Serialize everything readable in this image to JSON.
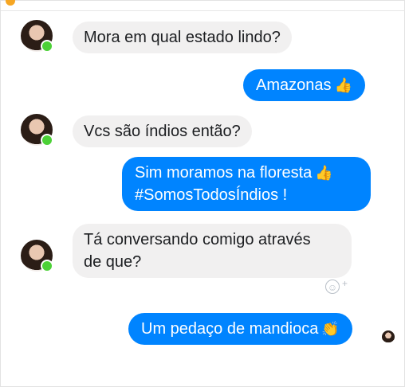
{
  "messages": [
    {
      "from": "them",
      "text": "Mora em qual estado lindo?"
    },
    {
      "from": "me",
      "text": "Amazonas",
      "emoji": "👍"
    },
    {
      "from": "them",
      "text": "Vcs são índios então?"
    },
    {
      "from": "me",
      "line1": "Sim moramos na floresta",
      "emoji": "👍",
      "line2": "#SomosTodosÍndios !"
    },
    {
      "from": "them",
      "line1": "Tá conversando comigo através",
      "line2": "de que?"
    },
    {
      "from": "me",
      "text": "Um pedaço de mandioca",
      "emoji": "👏"
    }
  ],
  "reaction": {
    "icon": "smiley-icon",
    "plus": "+"
  },
  "colors": {
    "outgoing": "#0084ff",
    "incoming": "#f1f0f0",
    "online": "#4cd137"
  }
}
